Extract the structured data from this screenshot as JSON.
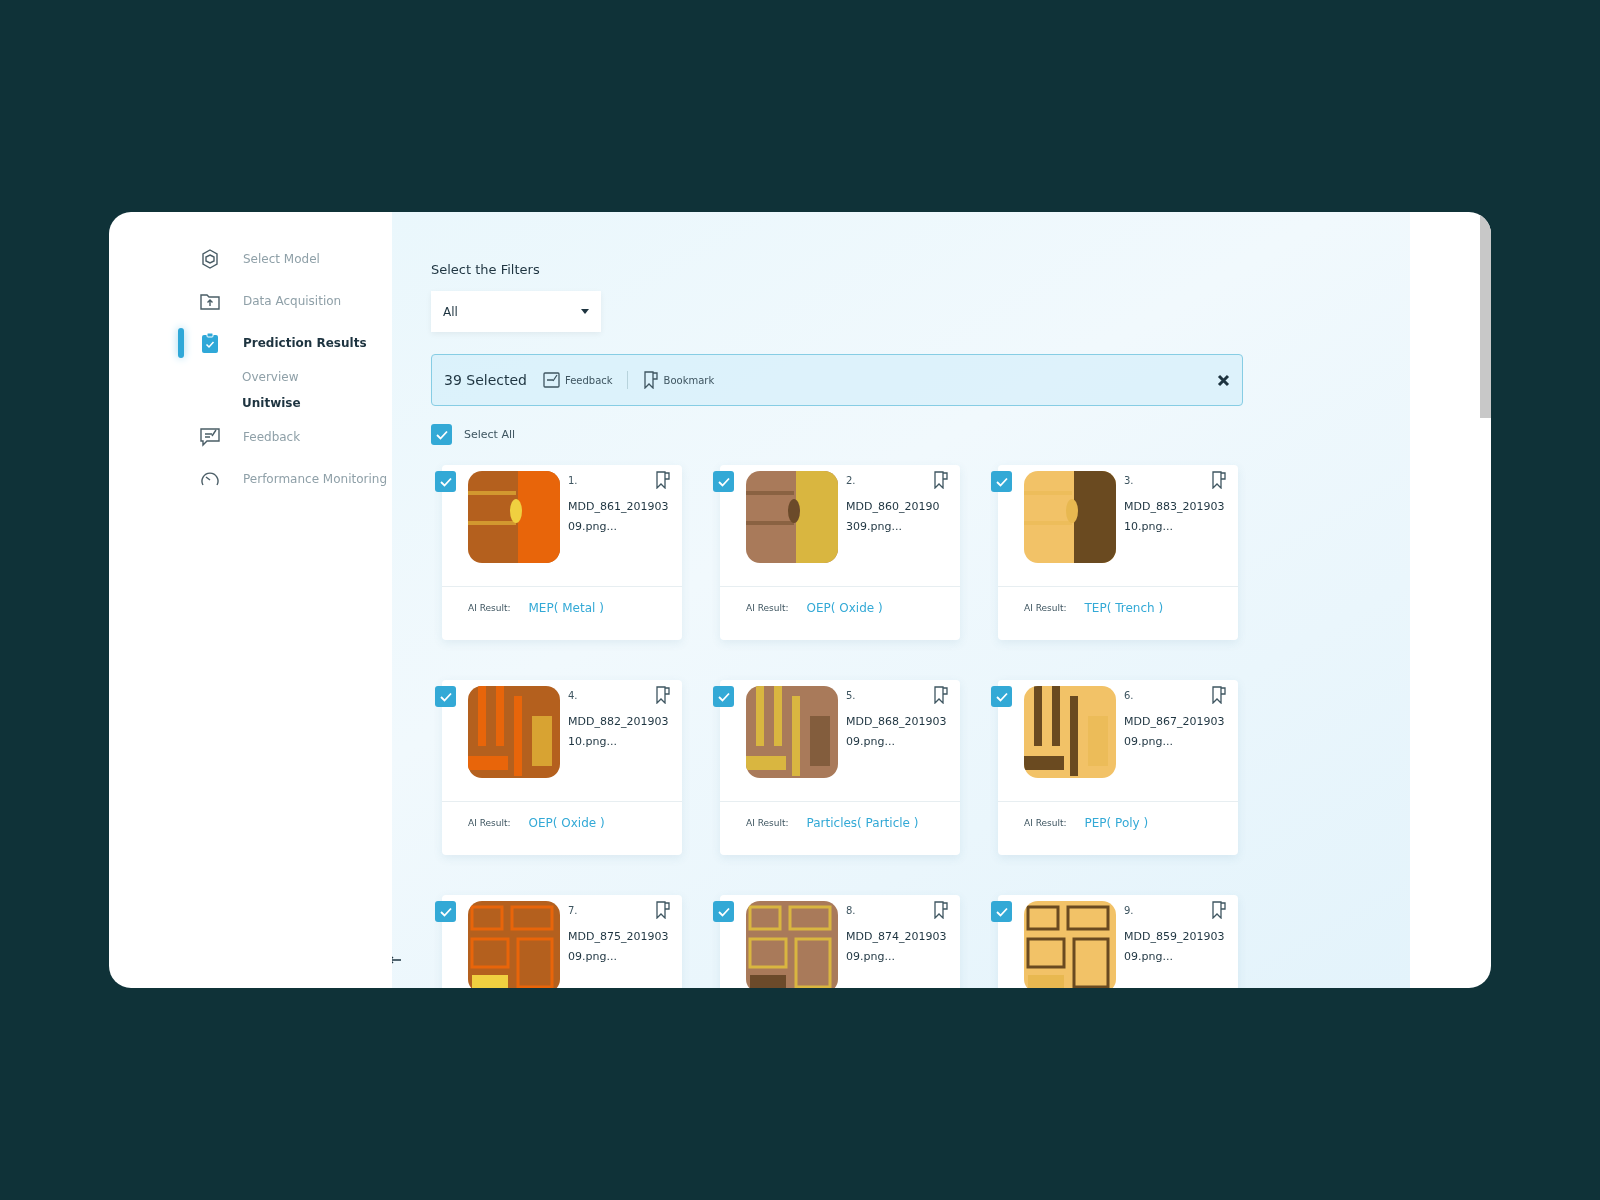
{
  "sidebar": {
    "items": [
      {
        "label": "Select Model",
        "selected": false,
        "kind": "model"
      },
      {
        "label": "Data Acquisition",
        "selected": false,
        "kind": "folder"
      },
      {
        "label": "Prediction Results",
        "selected": true,
        "kind": "clipboard",
        "children": [
          {
            "label": "Overview",
            "selected": false
          },
          {
            "label": "Unitwise",
            "selected": true
          }
        ]
      },
      {
        "label": "Feedback",
        "selected": false,
        "kind": "feedback"
      },
      {
        "label": "Performance Monitoring",
        "selected": false,
        "kind": "gauge"
      }
    ]
  },
  "filters": {
    "title": "Select the Filters",
    "dropdown": {
      "value": "All"
    }
  },
  "selection_bar": {
    "count": "39 Selected",
    "actions": [
      {
        "label": "Feedback",
        "kind": "feedback"
      },
      {
        "label": "Bookmark",
        "kind": "bookmark"
      }
    ]
  },
  "select_all": {
    "label": "Select All",
    "checked": true
  },
  "cards": [
    {
      "number": "1.",
      "name": "MDD_861_201903 09.png...",
      "result_label": "AI Result:",
      "result": "MEP( Metal )",
      "checked": true
    },
    {
      "number": "2.",
      "name": "MDD_860_20190 309.png...",
      "result_label": "AI Result:",
      "result": "OEP( Oxide )",
      "checked": true
    },
    {
      "number": "3.",
      "name": "MDD_883_201903 10.png...",
      "result_label": "AI Result:",
      "result": "TEP( Trench )",
      "checked": true
    },
    {
      "number": "4.",
      "name": "MDD_882_201903 10.png...",
      "result_label": "AI Result:",
      "result": "OEP( Oxide )",
      "checked": true
    },
    {
      "number": "5.",
      "name": "MDD_868_201903 09.png...",
      "result_label": "AI Result:",
      "result": "Particles( Particle )",
      "checked": true
    },
    {
      "number": "6.",
      "name": "MDD_867_201903 09.png...",
      "result_label": "AI Result:",
      "result": "PEP( Poly )",
      "checked": true
    },
    {
      "number": "7.",
      "name": "MDD_875_201903 09.png...",
      "checked": true
    },
    {
      "number": "8.",
      "name": "MDD_874_201903 09.png...",
      "checked": true
    },
    {
      "number": "9.",
      "name": "MDD_859_201903 09.png...",
      "checked": true
    }
  ]
}
